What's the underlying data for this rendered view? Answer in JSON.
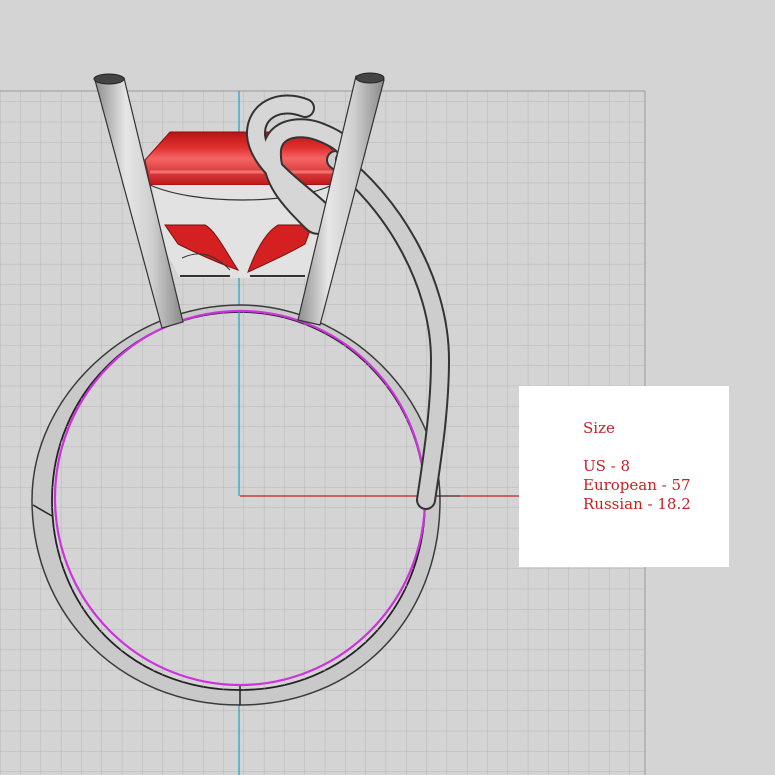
{
  "viewport": {
    "background_color": "#d4d4d4",
    "grid_color": "#b8b8b8",
    "grid_border_color": "#8f8f8f",
    "x_axis_color": "#c81e1e",
    "y_axis_color": "#1aa6b8"
  },
  "model": {
    "metal_color": "#c6c6c6",
    "metal_edge_color": "#3a3a3a",
    "stone_color": "#d41e1e",
    "stone_highlight_color": "#f05a5a",
    "inner_circle_color": "#cc33dd"
  },
  "size_panel": {
    "title": "Size",
    "us": "US - 8",
    "european": "European - 57",
    "russian": "Russian - 18.2",
    "text_color": "#c62222",
    "background_color": "#ffffff"
  }
}
